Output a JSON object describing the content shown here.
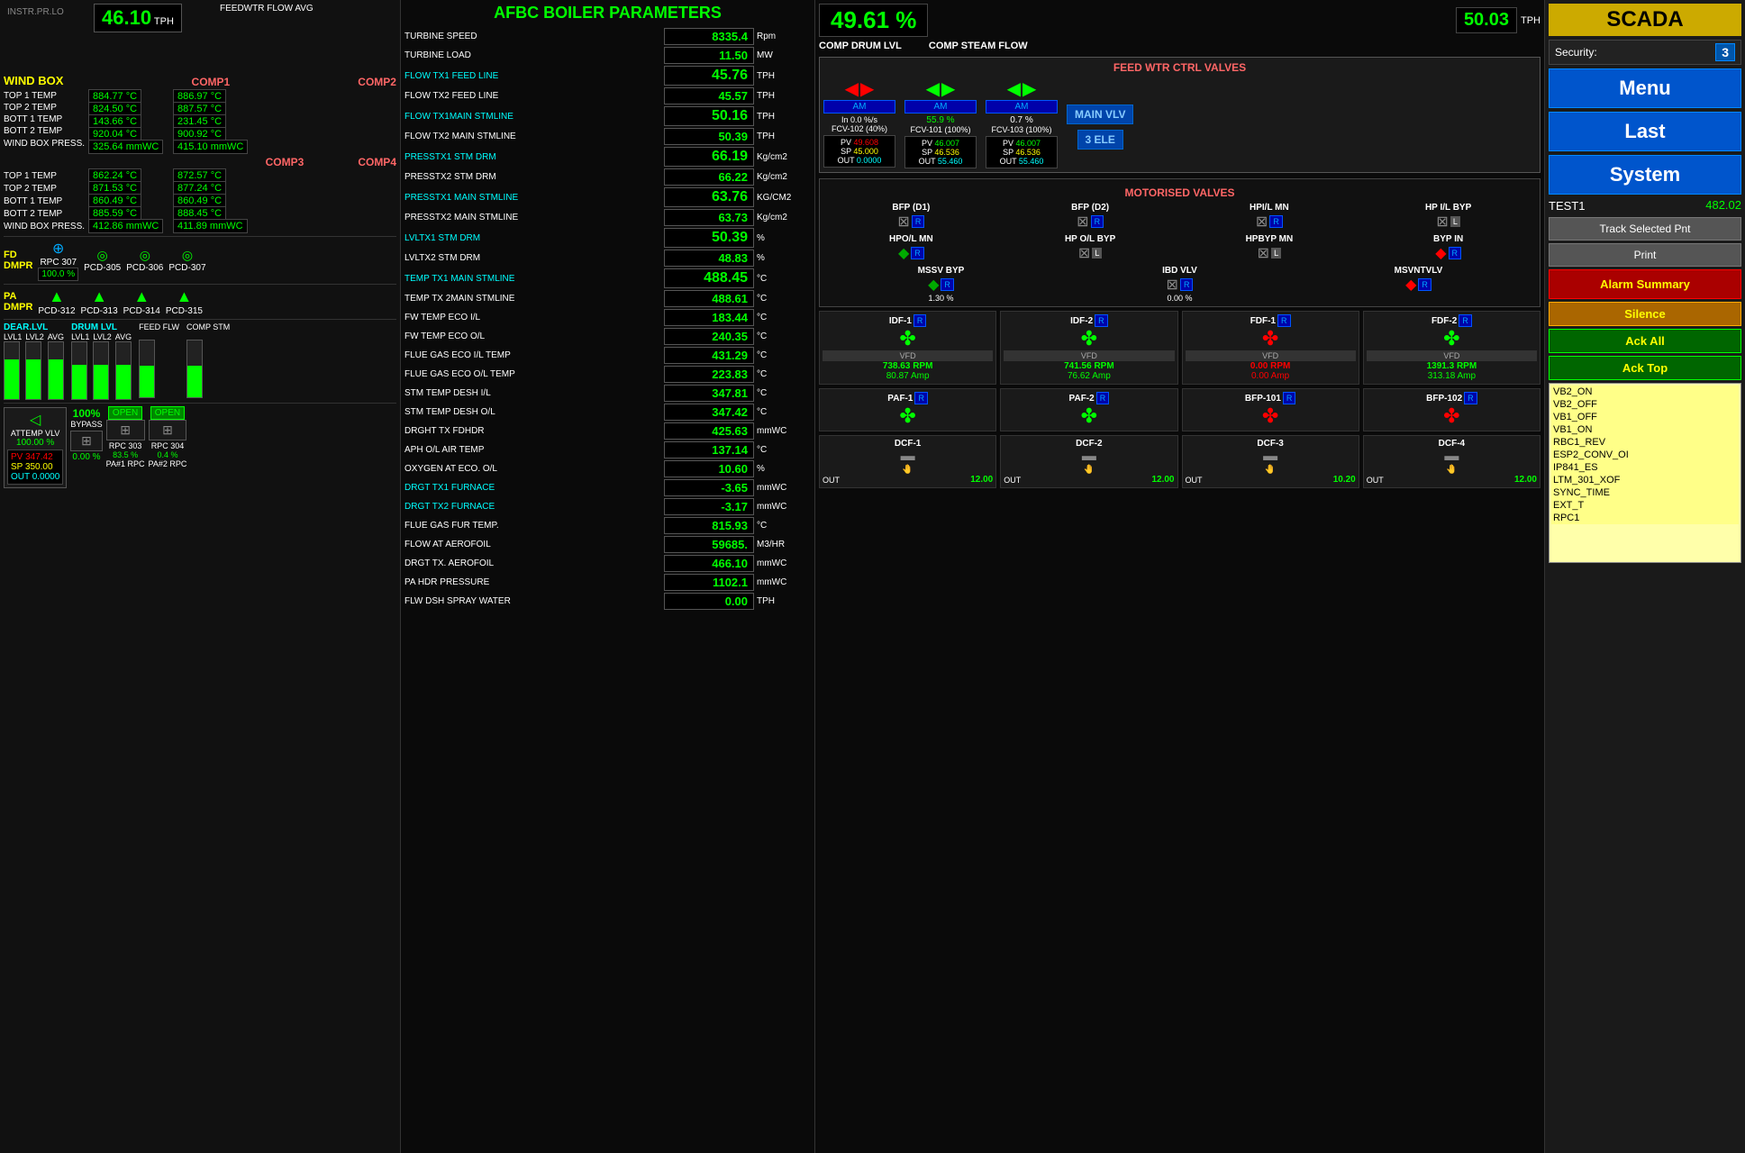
{
  "header": {
    "instr_label": "INSTR.PR.LO",
    "tph_value": "46.10",
    "tph_unit": "TPH",
    "feedwtr_label": "FEEDWTR FLOW AVG",
    "big_pct": "49.61 %",
    "big_tph": "50.03",
    "big_tph_unit": "TPH",
    "comp_drum_label": "COMP DRUM LVL",
    "comp_steam_label": "COMP STEAM FLOW"
  },
  "wind_box": {
    "title": "WIND BOX",
    "comp1_title": "COMP1",
    "comp2_title": "COMP2",
    "comp3_title": "COMP3",
    "comp4_title": "COMP4",
    "comp1": {
      "top1": "884.77 °C",
      "top2": "824.50 °C",
      "bott1": "143.66 °C",
      "bott2": "920.04 °C",
      "press": "325.64 mmWC"
    },
    "comp2": {
      "top1": "886.97 °C",
      "top2": "887.57 °C",
      "bott1": "231.45 °C",
      "bott2": "900.92 °C",
      "press": "415.10 mmWC"
    },
    "comp3": {
      "top1": "862.24 °C",
      "top2": "871.53 °C",
      "bott1": "860.49 °C",
      "bott2": "885.59 °C",
      "press": "412.86 mmWC"
    },
    "comp4": {
      "top1": "872.57 °C",
      "top2": "877.24 °C",
      "bott1": "860.49 °C",
      "bott2": "888.45 °C",
      "press": "411.89 mmWC"
    }
  },
  "fd_dmpr": {
    "title": "FD DMPR",
    "rpc307_label": "RPC 307",
    "rpc307_pct": "100.0 %",
    "pcd305": "PCD-305",
    "pcd306": "PCD-306",
    "pcd307": "PCD-307"
  },
  "pa_dmpr": {
    "title": "PA DMPR",
    "pcd312": "PCD-312",
    "pcd313": "PCD-313",
    "pcd314": "PCD-314",
    "pcd315": "PCD-315"
  },
  "levels": {
    "dear_lvl_title": "DEAR.LVL",
    "drum_lvl_title": "DRUM LVL",
    "feed_flw": "FEED FLW",
    "comp_stm": "COMP STM",
    "lvl1": "LVL1",
    "lvl2": "LVL2",
    "avg": "AVG"
  },
  "attemp": {
    "title": "ATTEMP VLV",
    "bypass_pct": "100%",
    "bypass_label": "BYPASS",
    "open1": "OPEN",
    "open2": "OPEN",
    "rpc303": "RPC 303",
    "rpc304": "RPC 304",
    "pa1_rpc": "PA#1 RPC",
    "pa2_rpc": "PA#2 RPC",
    "pv": "347.42",
    "sp": "350.00",
    "out": "0.0000",
    "pct_100": "100.00 %",
    "pct_0": "0.00 %",
    "pct_83": "83.5 %",
    "pct_04": "0.4 %"
  },
  "afbc": {
    "title": "AFBC BOILER PARAMETERS",
    "params": [
      {
        "name": "TURBINE SPEED",
        "value": "8335.4",
        "unit": "Rpm",
        "cyan": false
      },
      {
        "name": "TURBINE LOAD",
        "value": "11.50",
        "unit": "MW",
        "cyan": false
      },
      {
        "name": "FLOW TX1 FEED LINE",
        "value": "45.76",
        "unit": "TPH",
        "cyan": true,
        "large": true
      },
      {
        "name": "FLOW TX2 FEED LINE",
        "value": "45.57",
        "unit": "TPH",
        "cyan": false
      },
      {
        "name": "FLOW TX1MAIN STMLINE",
        "value": "50.16",
        "unit": "TPH",
        "cyan": true,
        "large": true
      },
      {
        "name": "FLOW TX2 MAIN STMLINE",
        "value": "50.39",
        "unit": "TPH",
        "cyan": false
      },
      {
        "name": "PRESSTX1 STM DRM",
        "value": "66.19",
        "unit": "Kg/cm2",
        "cyan": true,
        "large": true
      },
      {
        "name": "PRESSTX2 STM DRM",
        "value": "66.22",
        "unit": "Kg/cm2",
        "cyan": false
      },
      {
        "name": "PRESSTX1 MAIN STMLINE",
        "value": "63.76",
        "unit": "KG/CM2",
        "cyan": true,
        "large": true
      },
      {
        "name": "PRESSTX2 MAIN STMLINE",
        "value": "63.73",
        "unit": "Kg/cm2",
        "cyan": false
      },
      {
        "name": "LVLTX1 STM DRM",
        "value": "50.39",
        "unit": "%",
        "cyan": true,
        "large": true
      },
      {
        "name": "LVLTX2 STM DRM",
        "value": "48.83",
        "unit": "%",
        "cyan": false
      },
      {
        "name": "TEMP TX1 MAIN STMLINE",
        "value": "488.45",
        "unit": "°C",
        "cyan": true,
        "large": true
      },
      {
        "name": "TEMP TX 2MAIN STMLINE",
        "value": "488.61",
        "unit": "°C",
        "cyan": false
      },
      {
        "name": "FW TEMP ECO I/L",
        "value": "183.44",
        "unit": "°C",
        "cyan": false
      },
      {
        "name": "FW TEMP ECO O/L",
        "value": "240.35",
        "unit": "°C",
        "cyan": false
      },
      {
        "name": "FLUE GAS ECO I/L TEMP",
        "value": "431.29",
        "unit": "°C",
        "cyan": false
      },
      {
        "name": "FLUE GAS ECO O/L TEMP",
        "value": "223.83",
        "unit": "°C",
        "cyan": false
      },
      {
        "name": "STM TEMP DESH I/L",
        "value": "347.81",
        "unit": "°C",
        "cyan": false
      },
      {
        "name": "STM TEMP DESH O/L",
        "value": "347.42",
        "unit": "°C",
        "cyan": false
      },
      {
        "name": "DRGHT TX FDHDR",
        "value": "425.63",
        "unit": "mmWC",
        "cyan": false
      },
      {
        "name": "APH O/L AIR TEMP",
        "value": "137.14",
        "unit": "°C",
        "cyan": false
      },
      {
        "name": "OXYGEN AT ECO. O/L",
        "value": "10.60",
        "unit": "%",
        "cyan": false
      },
      {
        "name": "DRGT TX1 FURNACE",
        "value": "-3.65",
        "unit": "mmWC",
        "cyan": true
      },
      {
        "name": "DRGT TX2 FURNACE",
        "value": "-3.17",
        "unit": "mmWC",
        "cyan": true
      },
      {
        "name": "FLUE GAS FUR TEMP.",
        "value": "815.93",
        "unit": "°C",
        "cyan": false
      },
      {
        "name": "FLOW AT AEROFOIL",
        "value": "59685.",
        "unit": "M3/HR",
        "cyan": false
      },
      {
        "name": "DRGT TX. AEROFOIL",
        "value": "466.10",
        "unit": "mmWC",
        "cyan": false
      },
      {
        "name": "PA HDR PRESSURE",
        "value": "1102.1",
        "unit": "mmWC",
        "cyan": false
      },
      {
        "name": "FLW DSH SPRAY WATER",
        "value": "0.00",
        "unit": "TPH",
        "cyan": false
      }
    ]
  },
  "feed_ctrl": {
    "title": "FEED WTR CTRL VALVES",
    "valve1_label": "FCV-102 (40%)",
    "valve2_label": "FCV-101 (100%)",
    "valve3_label": "FCV-103 (100%)",
    "in_pct": "In 0.0 %/s",
    "v2_pct": "55.9 %",
    "v3_pct": "0.7 %",
    "fcv102": {
      "pv": "49.608",
      "sp": "45.000",
      "out": "0.0000"
    },
    "fcv101": {
      "pv": "46.007",
      "sp": "46.536",
      "out": "55.460"
    },
    "fcv103": {
      "pv": "46.007",
      "sp": "46.536",
      "out": "55.460"
    },
    "main_vlv": "MAIN VLV",
    "three_ele": "3 ELE"
  },
  "motorised": {
    "title": "MOTORISED VALVES",
    "valves": [
      {
        "label": "BFP (D1)",
        "badge": "R",
        "color": "green"
      },
      {
        "label": "BFP (D2)",
        "badge": "R",
        "color": "red"
      },
      {
        "label": "HPI/L MN",
        "badge": "R",
        "color": "green"
      },
      {
        "label": "HP I/L BYP",
        "badge": "L",
        "color": "green"
      },
      {
        "label": "HPO/L MN",
        "badge": "R",
        "color": "green"
      },
      {
        "label": "HP O/L BYP",
        "badge": "L",
        "color": "green"
      },
      {
        "label": "HPBYP MN",
        "badge": "L",
        "color": "green"
      },
      {
        "label": "BYP IN",
        "badge": "R",
        "color": "red"
      },
      {
        "label": "MSSV BYP",
        "badge": "R",
        "color": "green"
      },
      {
        "label": "IBD VLV",
        "badge": "R",
        "color": "green"
      },
      {
        "label": "MSVNTVLV",
        "badge": "R",
        "color": "red"
      }
    ],
    "mssv_pct": "1.30 %",
    "ibd_pct": "0.00 %"
  },
  "fans": {
    "idf1": {
      "label": "IDF-1",
      "badge": "R",
      "rpm": "738.63 RPM",
      "amp": "80.87 Amp",
      "color": "green"
    },
    "idf2": {
      "label": "IDF-2",
      "badge": "R",
      "rpm": "741.56 RPM",
      "amp": "76.62 Amp",
      "color": "green"
    },
    "fdf1": {
      "label": "FDF-1",
      "badge": "R",
      "rpm": "0.00 RPM",
      "amp": "0.00 Amp",
      "color": "red"
    },
    "fdf2": {
      "label": "FDF-2",
      "badge": "R",
      "rpm": "1391.3 RPM",
      "amp": "313.18 Amp",
      "color": "green"
    },
    "paf1": {
      "label": "PAF-1",
      "badge": "R",
      "color": "green"
    },
    "paf2": {
      "label": "PAF-2",
      "badge": "R",
      "color": "green"
    },
    "bfp101": {
      "label": "BFP-101",
      "badge": "R",
      "color": "red"
    },
    "bfp102": {
      "label": "BFP-102",
      "badge": "R",
      "color": "red"
    },
    "dcf1": {
      "label": "DCF-1",
      "val": "12.00"
    },
    "dcf2": {
      "label": "DCF-2",
      "val": "12.00"
    },
    "dcf3": {
      "label": "DCF-3",
      "val": "10.20"
    },
    "dcf4": {
      "label": "DCF-4",
      "val": "12.00"
    }
  },
  "scada": {
    "title": "SCADA",
    "security_label": "Security:",
    "security_value": "3",
    "menu": "Menu",
    "last": "Last",
    "system": "System",
    "test1": "TEST1",
    "test1_val": "482.02",
    "track": "Track Selected Pnt",
    "print": "Print",
    "alarm_summary": "Alarm Summary",
    "silence": "Silence",
    "ack_all": "Ack All",
    "ack_top": "Ack Top",
    "alarms": [
      {
        "text": "VB2_ON",
        "type": "yellow"
      },
      {
        "text": "VB2_OFF",
        "type": "yellow"
      },
      {
        "text": "VB1_OFF",
        "type": "yellow"
      },
      {
        "text": "VB1_ON",
        "type": "yellow"
      },
      {
        "text": "RBC1_REV",
        "type": "yellow"
      },
      {
        "text": "ESP2_CONV_OI",
        "type": "yellow"
      },
      {
        "text": "IP841_ES",
        "type": "yellow"
      },
      {
        "text": "LTM_301_XOF",
        "type": "yellow"
      },
      {
        "text": "SYNC_TIME",
        "type": "yellow"
      },
      {
        "text": "EXT_T",
        "type": "yellow"
      },
      {
        "text": "RPC1",
        "type": "yellow"
      }
    ]
  }
}
